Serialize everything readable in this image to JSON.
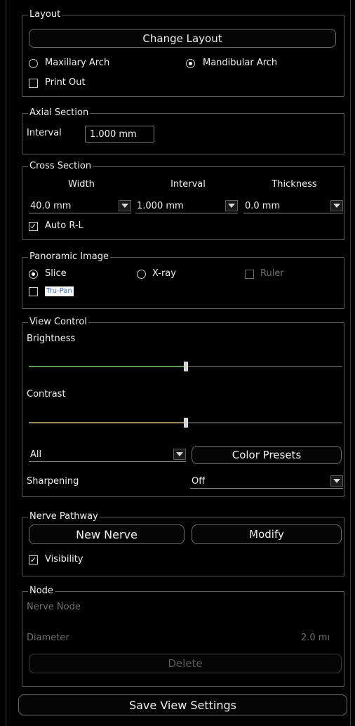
{
  "layout": {
    "legend": "Layout",
    "change_layout": "Change Layout",
    "maxillary": "Maxillary Arch",
    "mandibular": "Mandibular Arch",
    "print_out": "Print Out"
  },
  "axial": {
    "legend": "Axial Section",
    "interval_label": "Interval",
    "interval_value": "1.000 mm"
  },
  "cross": {
    "legend": "Cross Section",
    "width_label": "Width",
    "interval_label": "Interval",
    "thickness_label": "Thickness",
    "width_value": "40.0 mm",
    "interval_value": "1.000 mm",
    "thickness_value": "0.0 mm",
    "auto_rl": "Auto R-L"
  },
  "panoramic": {
    "legend": "Panoramic Image",
    "slice": "Slice",
    "xray": "X-ray",
    "ruler": "Ruler",
    "trupan": "Tru-Pan"
  },
  "view": {
    "legend": "View Control",
    "brightness": "Brightness",
    "contrast": "Contrast",
    "brightness_level": 0.5,
    "contrast_level": 0.5,
    "brightness_color": "#5a9a5a",
    "contrast_color": "#9a8a5a",
    "channel_value": "All",
    "color_presets": "Color Presets",
    "sharpening_label": "Sharpening",
    "sharpening_value": "Off"
  },
  "nerve": {
    "legend": "Nerve Pathway",
    "new_nerve": "New Nerve",
    "modify": "Modify",
    "visibility": "Visibility"
  },
  "node": {
    "legend": "Node",
    "nerve_node": "Nerve Node",
    "diameter": "Diameter",
    "diameter_value": "2.0 mı",
    "delete": "Delete"
  },
  "footer": {
    "save": "Save View Settings"
  }
}
